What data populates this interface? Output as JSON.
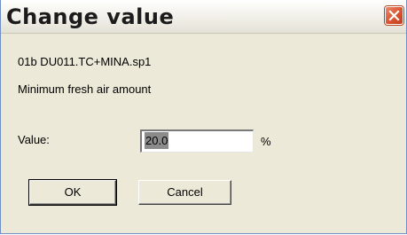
{
  "window": {
    "title": "Change value",
    "close_icon": "close-x-icon"
  },
  "content": {
    "id_line": "01b  DU011.TC+MINA.sp1",
    "description": "Minimum fresh air amount",
    "value_label": "Value:",
    "value": "20.0",
    "unit": "%"
  },
  "buttons": {
    "ok": "OK",
    "cancel": "Cancel"
  },
  "colors": {
    "dialog_bg": "#ece9d8",
    "close_button": "#d9532f",
    "selection": "#8b8b8b"
  }
}
